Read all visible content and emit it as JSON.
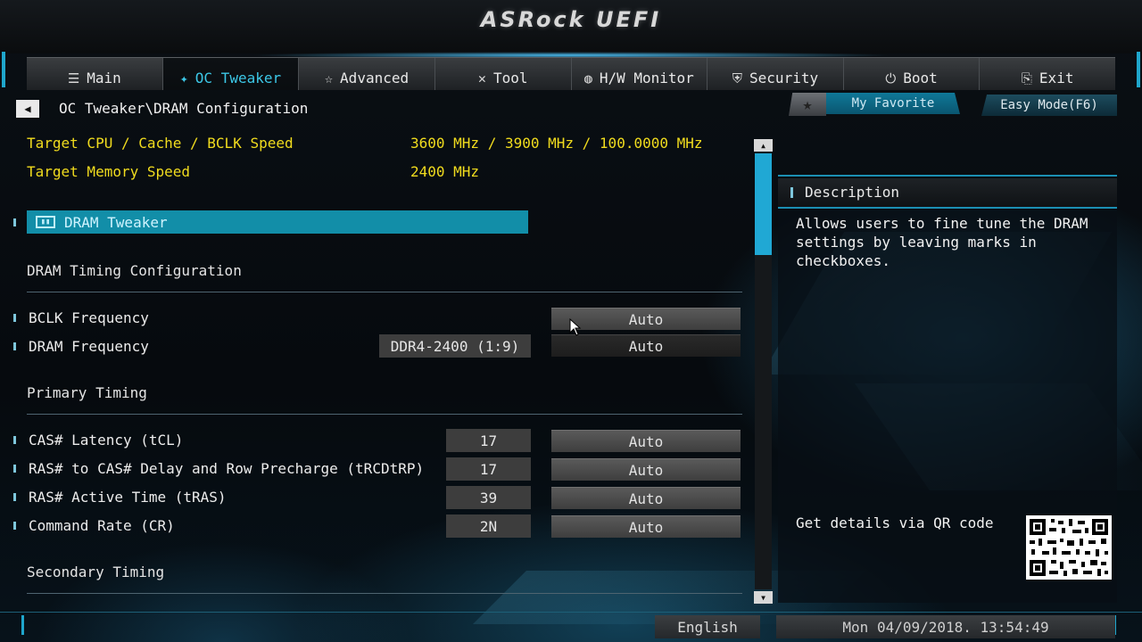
{
  "header": {
    "logo": "ASRock UEFI",
    "tabs": [
      {
        "label": "Main",
        "icon": "list-icon",
        "glyph": "☰"
      },
      {
        "label": "OC Tweaker",
        "icon": "rocket-icon",
        "glyph": "✦"
      },
      {
        "label": "Advanced",
        "icon": "star-outline-icon",
        "glyph": "☆"
      },
      {
        "label": "Tool",
        "icon": "tools-icon",
        "glyph": "✕"
      },
      {
        "label": "H/W Monitor",
        "icon": "monitor-gauge-icon",
        "glyph": "◍"
      },
      {
        "label": "Security",
        "icon": "shield-icon",
        "glyph": "⛨"
      },
      {
        "label": "Boot",
        "icon": "power-icon",
        "glyph": "⏻"
      },
      {
        "label": "Exit",
        "icon": "exit-door-icon",
        "glyph": "⎘"
      }
    ],
    "active_tab": "OC Tweaker"
  },
  "breadcrumb": "OC Tweaker\\DRAM Configuration",
  "favorite": {
    "label": "My Favorite"
  },
  "easy_mode": {
    "label": "Easy Mode(F6)"
  },
  "info": {
    "cpu_label": "Target CPU / Cache / BCLK Speed",
    "cpu_value": "3600 MHz / 3900 MHz / 100.0000 MHz",
    "mem_label": "Target Memory Speed",
    "mem_value": "2400 MHz"
  },
  "dram_tweaker": {
    "label": "DRAM Tweaker"
  },
  "groups": {
    "timing_config": "DRAM Timing Configuration",
    "primary": "Primary Timing",
    "secondary": "Secondary Timing"
  },
  "settings": {
    "bclk": {
      "label": "BCLK Frequency",
      "option": "Auto"
    },
    "dram_freq": {
      "label": "DRAM Frequency",
      "current": "DDR4-2400 (1:9)",
      "option": "Auto"
    },
    "cas": {
      "label": "CAS# Latency (tCL)",
      "current": "17",
      "option": "Auto"
    },
    "trcdtrp": {
      "label": "RAS# to CAS# Delay and Row Precharge (tRCDtRP)",
      "current": "17",
      "option": "Auto"
    },
    "tras": {
      "label": "RAS# Active Time (tRAS)",
      "current": "39",
      "option": "Auto"
    },
    "cr": {
      "label": "Command Rate (CR)",
      "current": "2N",
      "option": "Auto"
    }
  },
  "description": {
    "title": "Description",
    "text": "Allows users to fine tune the DRAM settings by leaving marks in checkboxes.",
    "qr_label": "Get details via QR code"
  },
  "footer": {
    "language": "English",
    "datetime": "Mon 04/09/2018. 13:54:49"
  }
}
